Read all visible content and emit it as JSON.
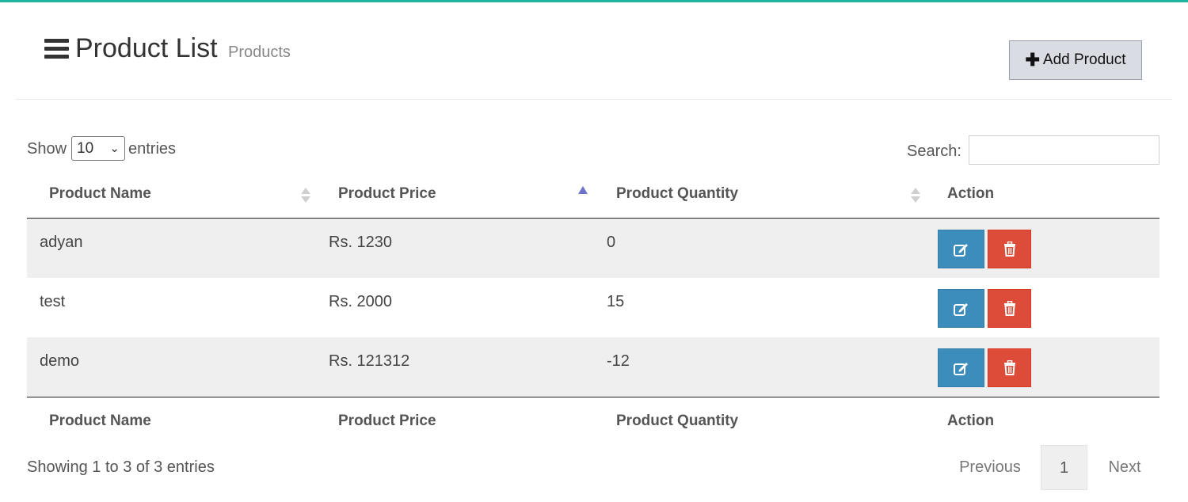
{
  "header": {
    "title": "Product List",
    "subtitle": "Products",
    "add_button_label": "Add Product"
  },
  "controls": {
    "show_label": "Show",
    "entries_per_page": "10",
    "entries_label": "entries",
    "search_label": "Search:",
    "search_value": ""
  },
  "table": {
    "columns": [
      "Product Name",
      "Product Price",
      "Product Quantity",
      "Action"
    ],
    "sorted_column": "Product Price",
    "sort_direction": "ascending",
    "rows": [
      {
        "name": "adyan",
        "price": "Rs. 1230",
        "quantity": "0"
      },
      {
        "name": "test",
        "price": "Rs. 2000",
        "quantity": "15"
      },
      {
        "name": "demo",
        "price": "Rs. 121312",
        "quantity": "-12"
      }
    ]
  },
  "footer": {
    "info": "Showing 1 to 3 of 3 entries",
    "previous_label": "Previous",
    "current_page": "1",
    "next_label": "Next"
  },
  "colors": {
    "top_accent": "#1fb59e",
    "edit_button": "#3c8dbc",
    "delete_button": "#dd4b39",
    "sort_active": "#6b74c9"
  },
  "icons": {
    "menu": "bars-icon",
    "add": "plus-icon",
    "edit": "edit-icon",
    "delete": "trash-icon"
  }
}
